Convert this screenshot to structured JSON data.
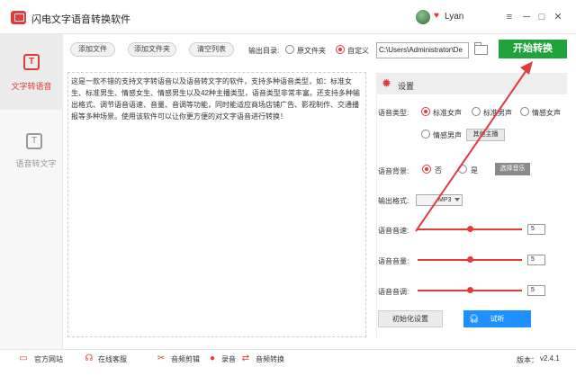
{
  "window": {
    "title": "闪电文字语音转换软件",
    "user_name": "Lyan",
    "controls": [
      "─",
      "□",
      "✕"
    ]
  },
  "sidebar": {
    "items": [
      {
        "label": "文字转语音",
        "icon": "text-to-speech-icon",
        "glyph": "T",
        "active": true
      },
      {
        "label": "语音转文字",
        "icon": "speech-to-text-icon",
        "glyph": "T",
        "active": false
      }
    ]
  },
  "toolbar": {
    "add_file": "添加文件",
    "add_folder": "添加文件夹",
    "clear_list": "清空列表",
    "output_dir_label": "输出目录:",
    "radio_source": "原文件夹",
    "radio_custom": "自定义",
    "output_path": "C:\\Users\\Administrator\\De",
    "start_button": "开始转换"
  },
  "text": {
    "content": "这是一款不错的支持文字转语音以及语音转文字的软件，支持多种语音类型，如：标准女生、标准男生、情感女生、情感男生以及42种主播类型，语音类型非常丰富。还支持多种输出格式、调节语音语速、音量、音调等功能，同时能适应商场店铺广告、影视制作、交通播报等多种场景。使用该软件可以让你更方便的对文字语音进行转换！"
  },
  "settings": {
    "title": "设置",
    "voice_type_label": "语音类型:",
    "voice_types": [
      "标准女声",
      "标准男声",
      "情感女声",
      "情感男声"
    ],
    "voice_selected": "标准女声",
    "other_anchor_button": "其他主播",
    "bg_label": "语音背景:",
    "bg_no": "否",
    "bg_yes": "是",
    "bg_selected": "否",
    "choose_music_button": "选择音乐",
    "format_label": "输出格式:",
    "format_value": "MP3",
    "speed_label": "语音音速:",
    "speed_value": "5",
    "volume_label": "语音音量:",
    "volume_value": "5",
    "pitch_label": "语音音调:",
    "pitch_value": "5",
    "slider_level": 0.5,
    "init_button": "初始化设置",
    "listen_button": "试听"
  },
  "footer": {
    "items": [
      "官方网站",
      "在线客服",
      "音频剪辑",
      "录音",
      "音频转换"
    ],
    "version_label": "版本：",
    "version_value": "v2.4.1"
  },
  "colors": {
    "accent_red": "#e23b3b",
    "start_green": "#1fa33a",
    "listen_blue": "#1e90ff"
  }
}
